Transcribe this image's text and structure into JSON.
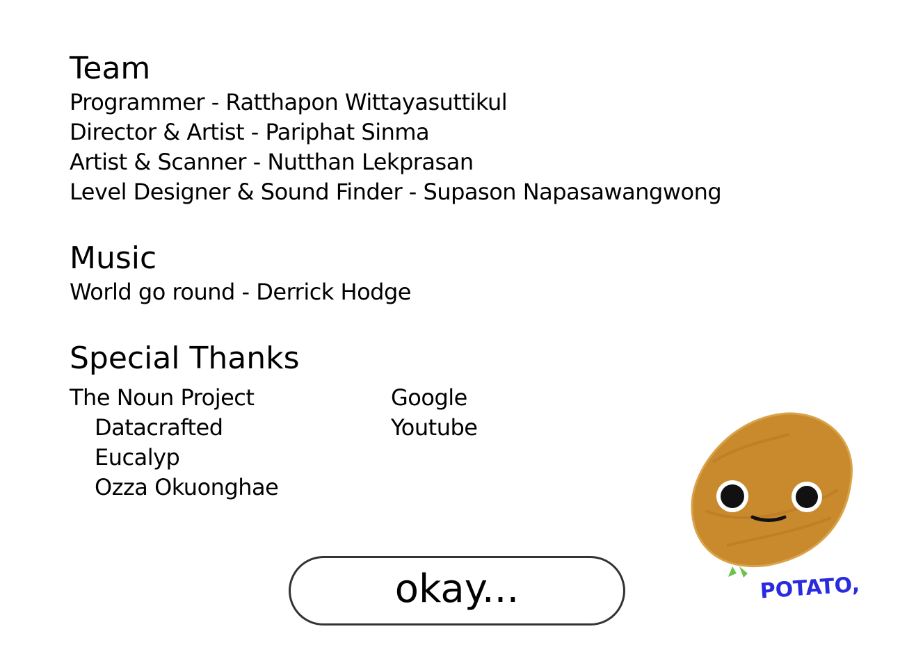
{
  "team": {
    "heading": "Team",
    "lines": [
      "Programmer - Ratthapon Wittayasuttikul",
      "Director & Artist - Pariphat Sinma",
      "Artist & Scanner - Nutthan Lekprasan",
      "Level Designer & Sound Finder - Supason Napasawangwong"
    ]
  },
  "music": {
    "heading": "Music",
    "lines": [
      "World go round - Derrick Hodge"
    ]
  },
  "special_thanks": {
    "heading": "Special Thanks",
    "left": {
      "title": "The Noun Project",
      "sub": [
        "Datacrafted",
        "Eucalyp",
        "Ozza Okuonghae"
      ]
    },
    "right": [
      "Google",
      "Youtube"
    ]
  },
  "button": {
    "label": "okay..."
  },
  "mascot": {
    "caption": "POTATO,",
    "caption_color": "#2a2adf",
    "body_color": "#c98a2e"
  }
}
